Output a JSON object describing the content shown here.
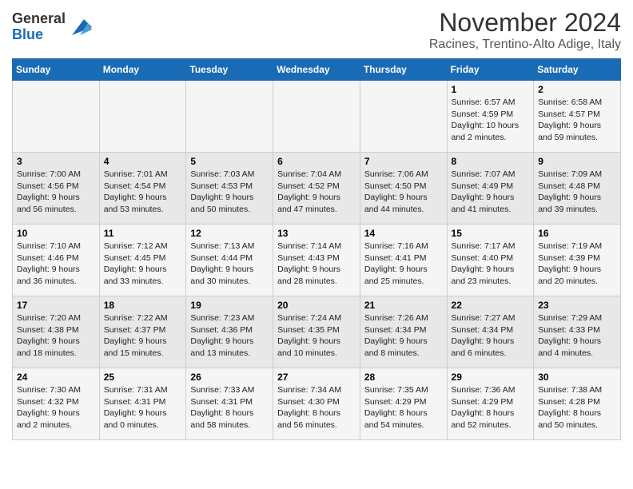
{
  "logo": {
    "general": "General",
    "blue": "Blue"
  },
  "title": "November 2024",
  "location": "Racines, Trentino-Alto Adige, Italy",
  "weekdays": [
    "Sunday",
    "Monday",
    "Tuesday",
    "Wednesday",
    "Thursday",
    "Friday",
    "Saturday"
  ],
  "weeks": [
    [
      {
        "day": "",
        "info": ""
      },
      {
        "day": "",
        "info": ""
      },
      {
        "day": "",
        "info": ""
      },
      {
        "day": "",
        "info": ""
      },
      {
        "day": "",
        "info": ""
      },
      {
        "day": "1",
        "info": "Sunrise: 6:57 AM\nSunset: 4:59 PM\nDaylight: 10 hours\nand 2 minutes."
      },
      {
        "day": "2",
        "info": "Sunrise: 6:58 AM\nSunset: 4:57 PM\nDaylight: 9 hours\nand 59 minutes."
      }
    ],
    [
      {
        "day": "3",
        "info": "Sunrise: 7:00 AM\nSunset: 4:56 PM\nDaylight: 9 hours\nand 56 minutes."
      },
      {
        "day": "4",
        "info": "Sunrise: 7:01 AM\nSunset: 4:54 PM\nDaylight: 9 hours\nand 53 minutes."
      },
      {
        "day": "5",
        "info": "Sunrise: 7:03 AM\nSunset: 4:53 PM\nDaylight: 9 hours\nand 50 minutes."
      },
      {
        "day": "6",
        "info": "Sunrise: 7:04 AM\nSunset: 4:52 PM\nDaylight: 9 hours\nand 47 minutes."
      },
      {
        "day": "7",
        "info": "Sunrise: 7:06 AM\nSunset: 4:50 PM\nDaylight: 9 hours\nand 44 minutes."
      },
      {
        "day": "8",
        "info": "Sunrise: 7:07 AM\nSunset: 4:49 PM\nDaylight: 9 hours\nand 41 minutes."
      },
      {
        "day": "9",
        "info": "Sunrise: 7:09 AM\nSunset: 4:48 PM\nDaylight: 9 hours\nand 39 minutes."
      }
    ],
    [
      {
        "day": "10",
        "info": "Sunrise: 7:10 AM\nSunset: 4:46 PM\nDaylight: 9 hours\nand 36 minutes."
      },
      {
        "day": "11",
        "info": "Sunrise: 7:12 AM\nSunset: 4:45 PM\nDaylight: 9 hours\nand 33 minutes."
      },
      {
        "day": "12",
        "info": "Sunrise: 7:13 AM\nSunset: 4:44 PM\nDaylight: 9 hours\nand 30 minutes."
      },
      {
        "day": "13",
        "info": "Sunrise: 7:14 AM\nSunset: 4:43 PM\nDaylight: 9 hours\nand 28 minutes."
      },
      {
        "day": "14",
        "info": "Sunrise: 7:16 AM\nSunset: 4:41 PM\nDaylight: 9 hours\nand 25 minutes."
      },
      {
        "day": "15",
        "info": "Sunrise: 7:17 AM\nSunset: 4:40 PM\nDaylight: 9 hours\nand 23 minutes."
      },
      {
        "day": "16",
        "info": "Sunrise: 7:19 AM\nSunset: 4:39 PM\nDaylight: 9 hours\nand 20 minutes."
      }
    ],
    [
      {
        "day": "17",
        "info": "Sunrise: 7:20 AM\nSunset: 4:38 PM\nDaylight: 9 hours\nand 18 minutes."
      },
      {
        "day": "18",
        "info": "Sunrise: 7:22 AM\nSunset: 4:37 PM\nDaylight: 9 hours\nand 15 minutes."
      },
      {
        "day": "19",
        "info": "Sunrise: 7:23 AM\nSunset: 4:36 PM\nDaylight: 9 hours\nand 13 minutes."
      },
      {
        "day": "20",
        "info": "Sunrise: 7:24 AM\nSunset: 4:35 PM\nDaylight: 9 hours\nand 10 minutes."
      },
      {
        "day": "21",
        "info": "Sunrise: 7:26 AM\nSunset: 4:34 PM\nDaylight: 9 hours\nand 8 minutes."
      },
      {
        "day": "22",
        "info": "Sunrise: 7:27 AM\nSunset: 4:34 PM\nDaylight: 9 hours\nand 6 minutes."
      },
      {
        "day": "23",
        "info": "Sunrise: 7:29 AM\nSunset: 4:33 PM\nDaylight: 9 hours\nand 4 minutes."
      }
    ],
    [
      {
        "day": "24",
        "info": "Sunrise: 7:30 AM\nSunset: 4:32 PM\nDaylight: 9 hours\nand 2 minutes."
      },
      {
        "day": "25",
        "info": "Sunrise: 7:31 AM\nSunset: 4:31 PM\nDaylight: 9 hours\nand 0 minutes."
      },
      {
        "day": "26",
        "info": "Sunrise: 7:33 AM\nSunset: 4:31 PM\nDaylight: 8 hours\nand 58 minutes."
      },
      {
        "day": "27",
        "info": "Sunrise: 7:34 AM\nSunset: 4:30 PM\nDaylight: 8 hours\nand 56 minutes."
      },
      {
        "day": "28",
        "info": "Sunrise: 7:35 AM\nSunset: 4:29 PM\nDaylight: 8 hours\nand 54 minutes."
      },
      {
        "day": "29",
        "info": "Sunrise: 7:36 AM\nSunset: 4:29 PM\nDaylight: 8 hours\nand 52 minutes."
      },
      {
        "day": "30",
        "info": "Sunrise: 7:38 AM\nSunset: 4:28 PM\nDaylight: 8 hours\nand 50 minutes."
      }
    ]
  ]
}
